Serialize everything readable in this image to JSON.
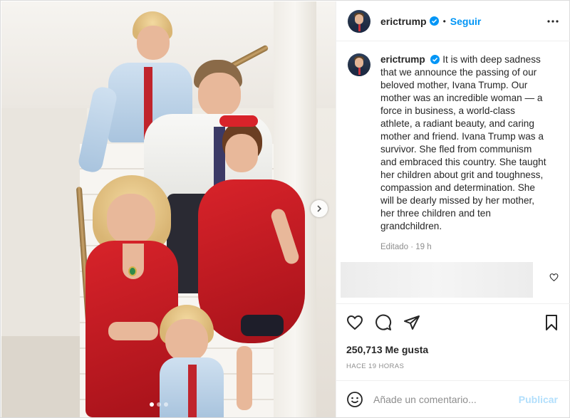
{
  "post": {
    "username": "erictrump",
    "verified": true,
    "follow_label": "Seguir",
    "separator": "•",
    "caption": "It is with deep sadness that we announce the passing of our beloved mother, Ivana Trump. Our mother was an incredible woman — a force in business, a world-class athlete, a radiant beauty, and caring mother and friend. Ivana Trump was a survivor. She fled from communism and embraced this country. She taught her children about grit and toughness, compassion and determination. She will be dearly missed by her mother, her three children and ten grandchildren.",
    "edited_label": "Editado",
    "edited_time": "19 h",
    "likes": "250,713 Me gusta",
    "posted_ago": "HACE 19 HORAS"
  },
  "carousel": {
    "dot_count": 3,
    "active_index": 0
  },
  "comment": {
    "placeholder": "Añade un comentario...",
    "publish_label": "Publicar"
  },
  "colors": {
    "accent": "#0095f6",
    "publish_disabled": "#b2dffc",
    "verified": "#0095f6"
  },
  "icons": {
    "header_more": "more-horizontal-icon",
    "like": "heart-icon",
    "comment": "comment-icon",
    "share": "share-icon",
    "save": "bookmark-icon",
    "emoji": "emoji-icon",
    "carousel_next": "chevron-right-icon"
  }
}
